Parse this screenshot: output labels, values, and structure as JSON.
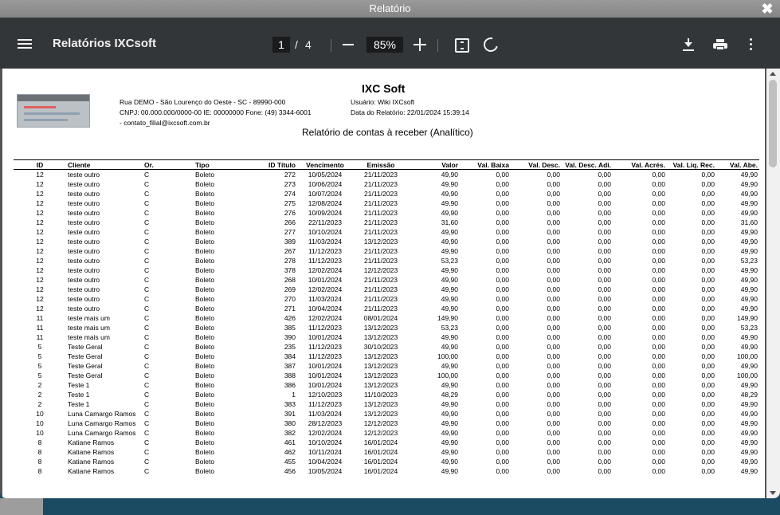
{
  "window": {
    "title": "Relatório"
  },
  "viewer": {
    "app_title": "Relatórios IXCsoft",
    "current_page": "1",
    "page_separator": "/",
    "total_pages": "4",
    "zoom": "85%",
    "icons": {
      "menu": "menu-icon",
      "zoom_out": "minus-icon",
      "zoom_in": "plus-icon",
      "fit": "fit-page-icon",
      "rotate": "rotate-icon",
      "download": "download-icon",
      "print": "print-icon",
      "more": "more-vert-icon",
      "close": "close-icon"
    }
  },
  "report": {
    "company": "IXC Soft",
    "address": "Rua DEMO - São Lourenço do Oeste - SC - 89990-000",
    "cnpj": "CNPJ: 00.000.000/0000-00  IE: 00000000  Fone: (49) 3344-6001",
    "email": " - contato_filial@ixcsoft.com.br",
    "user": "Usuário: Wiki IXCsoft",
    "report_date": "Data do Relatório: 22/01/2024 15:39:14",
    "title": "Relatório de contas à receber (Analítico)",
    "columns": [
      "ID",
      "Cliente",
      "Or.",
      "Tipo",
      "ID Título",
      "Vencimento",
      "Emissão",
      "Valor",
      "Val. Baixa",
      "Val. Desc.",
      "Val. Desc. Adi.",
      "Val. Acrés.",
      "Val. Liq. Rec.",
      "Val. Abe."
    ],
    "rows": [
      [
        "12",
        "teste outro",
        "C",
        "Boleto",
        "272",
        "10/05/2024",
        "21/11/2023",
        "49,90",
        "0,00",
        "0,00",
        "0,00",
        "0,00",
        "0,00",
        "49,90"
      ],
      [
        "12",
        "teste outro",
        "C",
        "Boleto",
        "273",
        "10/06/2024",
        "21/11/2023",
        "49,90",
        "0,00",
        "0,00",
        "0,00",
        "0,00",
        "0,00",
        "49,90"
      ],
      [
        "12",
        "teste outro",
        "C",
        "Boleto",
        "274",
        "10/07/2024",
        "21/11/2023",
        "49,90",
        "0,00",
        "0,00",
        "0,00",
        "0,00",
        "0,00",
        "49,90"
      ],
      [
        "12",
        "teste outro",
        "C",
        "Boleto",
        "275",
        "12/08/2024",
        "21/11/2023",
        "49,90",
        "0,00",
        "0,00",
        "0,00",
        "0,00",
        "0,00",
        "49,90"
      ],
      [
        "12",
        "teste outro",
        "C",
        "Boleto",
        "276",
        "10/09/2024",
        "21/11/2023",
        "49,90",
        "0,00",
        "0,00",
        "0,00",
        "0,00",
        "0,00",
        "49,90"
      ],
      [
        "12",
        "teste outro",
        "C",
        "Boleto",
        "266",
        "22/11/2023",
        "21/11/2023",
        "31,60",
        "0,00",
        "0,00",
        "0,00",
        "0,00",
        "0,00",
        "31,60"
      ],
      [
        "12",
        "teste outro",
        "C",
        "Boleto",
        "277",
        "10/10/2024",
        "21/11/2023",
        "49,90",
        "0,00",
        "0,00",
        "0,00",
        "0,00",
        "0,00",
        "49,90"
      ],
      [
        "12",
        "teste outro",
        "C",
        "Boleto",
        "389",
        "11/03/2024",
        "13/12/2023",
        "49,90",
        "0,00",
        "0,00",
        "0,00",
        "0,00",
        "0,00",
        "49,90"
      ],
      [
        "12",
        "teste outro",
        "C",
        "Boleto",
        "267",
        "11/12/2023",
        "21/11/2023",
        "49,90",
        "0,00",
        "0,00",
        "0,00",
        "0,00",
        "0,00",
        "49,90"
      ],
      [
        "12",
        "teste outro",
        "C",
        "Boleto",
        "278",
        "11/12/2023",
        "21/11/2023",
        "53,23",
        "0,00",
        "0,00",
        "0,00",
        "0,00",
        "0,00",
        "53,23"
      ],
      [
        "12",
        "teste outro",
        "C",
        "Boleto",
        "378",
        "12/02/2024",
        "12/12/2023",
        "49,90",
        "0,00",
        "0,00",
        "0,00",
        "0,00",
        "0,00",
        "49,90"
      ],
      [
        "12",
        "teste outro",
        "C",
        "Boleto",
        "268",
        "10/01/2024",
        "21/11/2023",
        "49,90",
        "0,00",
        "0,00",
        "0,00",
        "0,00",
        "0,00",
        "49,90"
      ],
      [
        "12",
        "teste outro",
        "C",
        "Boleto",
        "269",
        "12/02/2024",
        "21/11/2023",
        "49,90",
        "0,00",
        "0,00",
        "0,00",
        "0,00",
        "0,00",
        "49,90"
      ],
      [
        "12",
        "teste outro",
        "C",
        "Boleto",
        "270",
        "11/03/2024",
        "21/11/2023",
        "49,90",
        "0,00",
        "0,00",
        "0,00",
        "0,00",
        "0,00",
        "49,90"
      ],
      [
        "12",
        "teste outro",
        "C",
        "Boleto",
        "271",
        "10/04/2024",
        "21/11/2023",
        "49,90",
        "0,00",
        "0,00",
        "0,00",
        "0,00",
        "0,00",
        "49,90"
      ],
      [
        "11",
        "teste mais um",
        "C",
        "Boleto",
        "426",
        "12/02/2024",
        "08/01/2024",
        "149,90",
        "0,00",
        "0,00",
        "0,00",
        "0,00",
        "0,00",
        "149,90"
      ],
      [
        "11",
        "teste mais um",
        "C",
        "Boleto",
        "385",
        "11/12/2023",
        "13/12/2023",
        "53,23",
        "0,00",
        "0,00",
        "0,00",
        "0,00",
        "0,00",
        "53,23"
      ],
      [
        "11",
        "teste mais um",
        "C",
        "Boleto",
        "390",
        "10/01/2024",
        "13/12/2023",
        "49,90",
        "0,00",
        "0,00",
        "0,00",
        "0,00",
        "0,00",
        "49,90"
      ],
      [
        "5",
        "Teste Geral",
        "C",
        "Boleto",
        "235",
        "11/12/2023",
        "30/10/2023",
        "49,90",
        "0,00",
        "0,00",
        "0,00",
        "0,00",
        "0,00",
        "49,90"
      ],
      [
        "5",
        "Teste Geral",
        "C",
        "Boleto",
        "384",
        "11/12/2023",
        "13/12/2023",
        "100,00",
        "0,00",
        "0,00",
        "0,00",
        "0,00",
        "0,00",
        "100,00"
      ],
      [
        "5",
        "Teste Geral",
        "C",
        "Boleto",
        "387",
        "10/01/2024",
        "13/12/2023",
        "49,90",
        "0,00",
        "0,00",
        "0,00",
        "0,00",
        "0,00",
        "49,90"
      ],
      [
        "5",
        "Teste Geral",
        "C",
        "Boleto",
        "388",
        "10/01/2024",
        "13/12/2023",
        "100,00",
        "0,00",
        "0,00",
        "0,00",
        "0,00",
        "0,00",
        "100,00"
      ],
      [
        "2",
        "Teste 1",
        "C",
        "Boleto",
        "386",
        "10/01/2024",
        "13/12/2023",
        "49,90",
        "0,00",
        "0,00",
        "0,00",
        "0,00",
        "0,00",
        "49,90"
      ],
      [
        "2",
        "Teste 1",
        "C",
        "Boleto",
        "1",
        "12/10/2023",
        "11/10/2023",
        "48,29",
        "0,00",
        "0,00",
        "0,00",
        "0,00",
        "0,00",
        "48,29"
      ],
      [
        "2",
        "Teste 1",
        "C",
        "Boleto",
        "383",
        "11/12/2023",
        "13/12/2023",
        "49,90",
        "0,00",
        "0,00",
        "0,00",
        "0,00",
        "0,00",
        "49,90"
      ],
      [
        "10",
        "Luna Camargo Ramos",
        "C",
        "Boleto",
        "391",
        "11/03/2024",
        "13/12/2023",
        "49,90",
        "0,00",
        "0,00",
        "0,00",
        "0,00",
        "0,00",
        "49,90"
      ],
      [
        "10",
        "Luna Camargo Ramos",
        "C",
        "Boleto",
        "380",
        "28/12/2023",
        "12/12/2023",
        "49,90",
        "0,00",
        "0,00",
        "0,00",
        "0,00",
        "0,00",
        "49,90"
      ],
      [
        "10",
        "Luna Camargo Ramos",
        "C",
        "Boleto",
        "382",
        "12/02/2024",
        "12/12/2023",
        "49,90",
        "0,00",
        "0,00",
        "0,00",
        "0,00",
        "0,00",
        "49,90"
      ],
      [
        "8",
        "Katiane Ramos",
        "C",
        "Boleto",
        "461",
        "10/10/2024",
        "16/01/2024",
        "49,90",
        "0,00",
        "0,00",
        "0,00",
        "0,00",
        "0,00",
        "49,90"
      ],
      [
        "8",
        "Katiane Ramos",
        "C",
        "Boleto",
        "462",
        "10/11/2024",
        "16/01/2024",
        "49,90",
        "0,00",
        "0,00",
        "0,00",
        "0,00",
        "0,00",
        "49,90"
      ],
      [
        "8",
        "Katiane Ramos",
        "C",
        "Boleto",
        "455",
        "10/04/2024",
        "16/01/2024",
        "49,90",
        "0,00",
        "0,00",
        "0,00",
        "0,00",
        "0,00",
        "49,90"
      ],
      [
        "8",
        "Katiane Ramos",
        "C",
        "Boleto",
        "456",
        "10/05/2024",
        "16/01/2024",
        "49,90",
        "0,00",
        "0,00",
        "0,00",
        "0,00",
        "0,00",
        "49,90"
      ]
    ]
  }
}
